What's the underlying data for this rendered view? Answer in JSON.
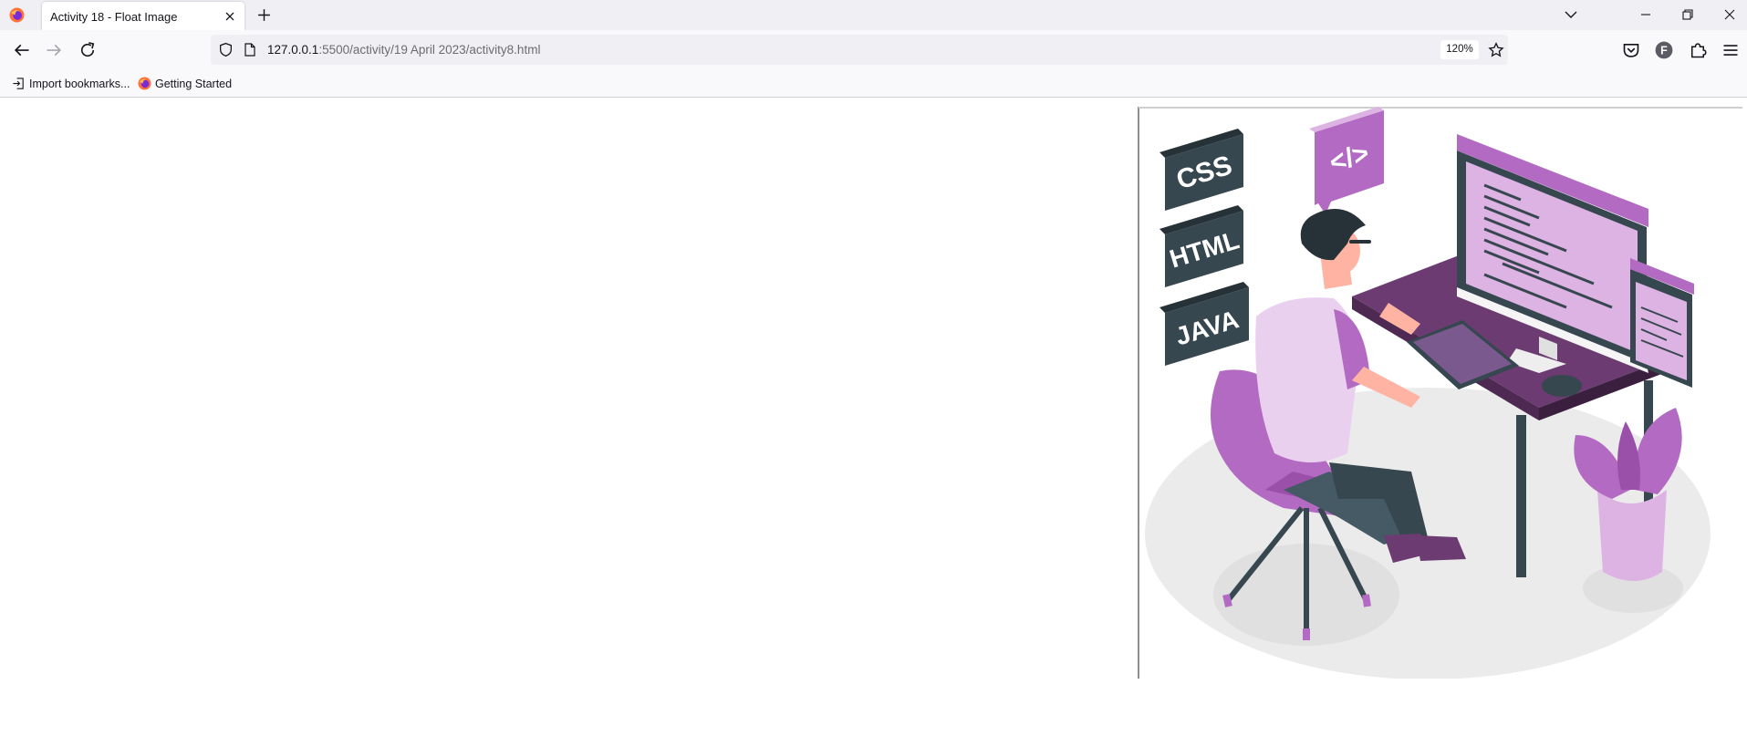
{
  "browser": {
    "tab": {
      "title": "Activity 18 - Float Image"
    },
    "url": {
      "host": "127.0.0.1",
      "path": ":5500/activity/19 April 2023/activity8.html"
    },
    "zoom": "120%",
    "bookmarks": [
      {
        "label": "Import bookmarks...",
        "icon": "import-icon"
      },
      {
        "label": "Getting Started",
        "icon": "firefox-icon"
      }
    ],
    "profile_initial": "F"
  },
  "page": {
    "image": {
      "alt": "Developer illustration",
      "labels": [
        "CSS",
        "HTML",
        "JAVA"
      ],
      "code_bubble": "</>"
    }
  },
  "colors": {
    "accent_purple": "#b36ac2",
    "light_purple": "#ddb3e3",
    "dark_purple": "#6b3b72",
    "slate": "#37474f",
    "floor": "#ebebeb"
  }
}
